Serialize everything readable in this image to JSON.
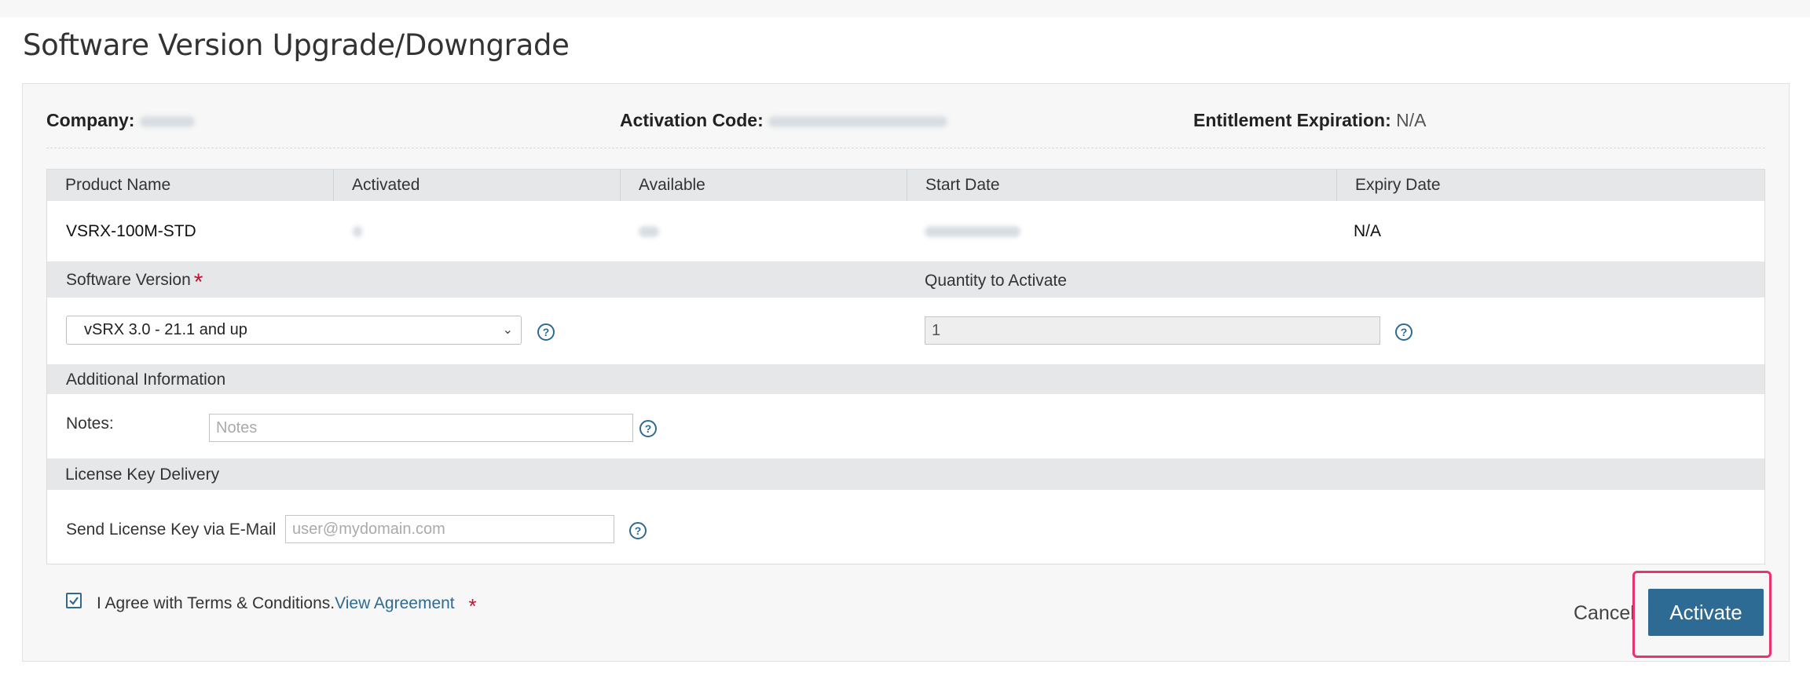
{
  "page": {
    "title": "Software Version Upgrade/Downgrade"
  },
  "info": {
    "company_label": "Company:",
    "activation_label": "Activation Code:",
    "expiration_label": "Entitlement Expiration:",
    "expiration_value": "N/A"
  },
  "table": {
    "headers": [
      "Product Name",
      "Activated",
      "Available",
      "Start Date",
      "Expiry Date"
    ],
    "row": {
      "product": "VSRX-100M-STD",
      "expiry": "N/A"
    }
  },
  "software": {
    "label": "Software Version",
    "required_mark": "*",
    "selected": "vSRX 3.0 - 21.1 and up",
    "quantity_label": "Quantity to Activate",
    "quantity_value": "1"
  },
  "additional": {
    "label": "Additional Information",
    "notes_label": "Notes:",
    "notes_placeholder": "Notes"
  },
  "delivery": {
    "label": "License Key Delivery",
    "email_label": "Send License Key via E-Mail",
    "email_placeholder": "user@mydomain.com"
  },
  "footer": {
    "agree_text": "I Agree with Terms & Conditions.",
    "agreement_link": "View Agreement",
    "required_mark": "*",
    "cancel_label": "Cancel",
    "activate_label": "Activate"
  },
  "colors": {
    "primary": "#2d6a94",
    "required": "#c8102e",
    "highlight": "#e8336d"
  },
  "icons": {
    "help": "question-circle-icon",
    "check": "checkmark-icon"
  }
}
